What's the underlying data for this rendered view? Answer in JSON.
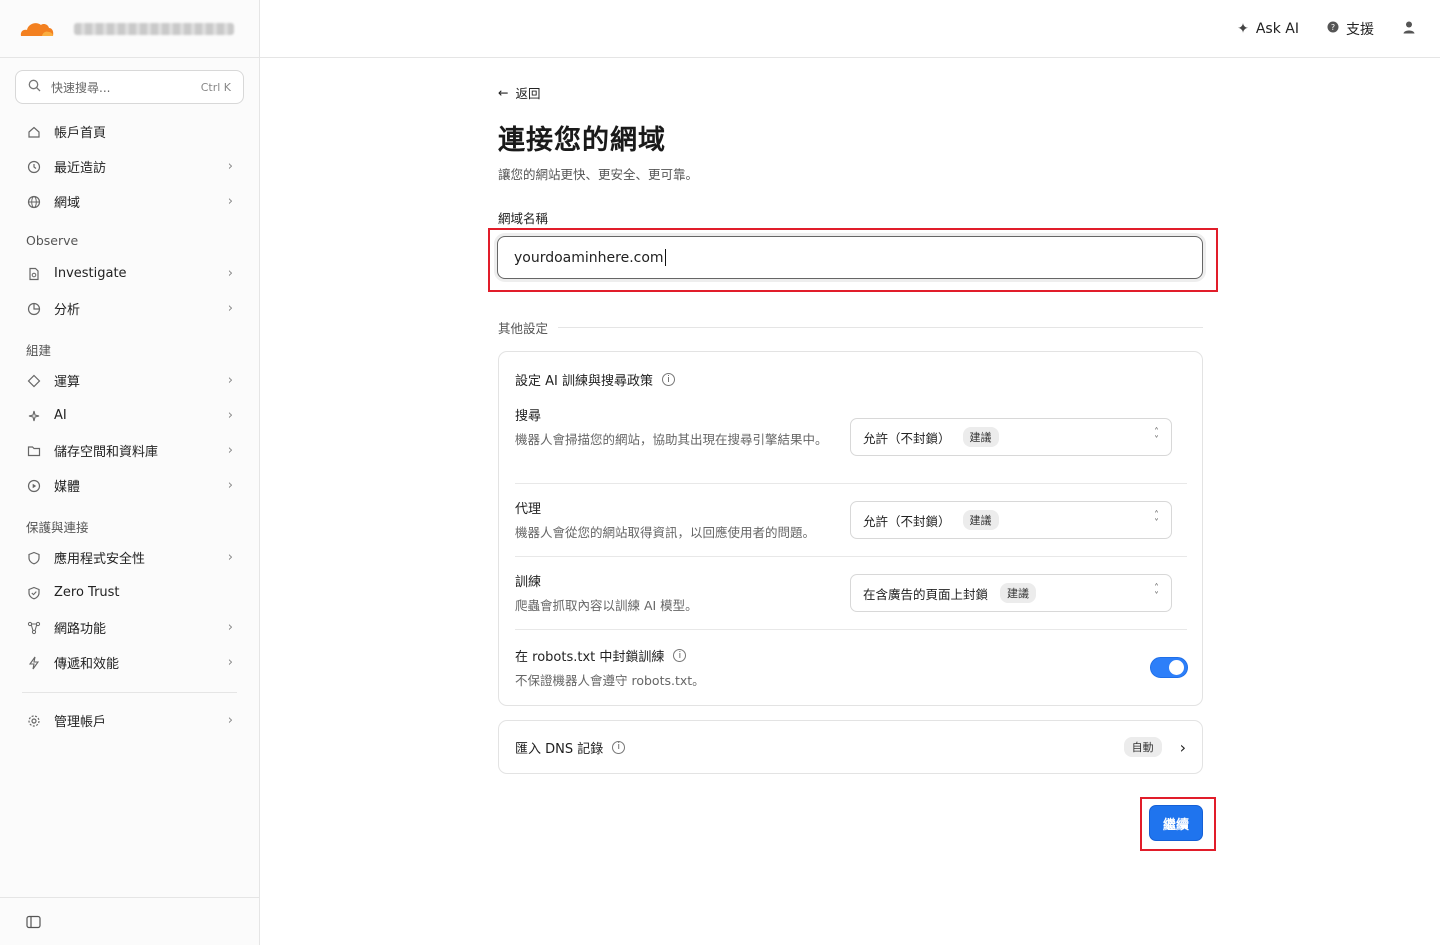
{
  "header": {
    "ask_ai": "Ask AI",
    "support": "支援"
  },
  "sidebar": {
    "search_placeholder": "快速搜尋...",
    "search_shortcut": "Ctrl K",
    "items_top": [
      {
        "label": "帳戶首頁"
      },
      {
        "label": "最近造訪"
      },
      {
        "label": "網域"
      }
    ],
    "section_observe": "Observe",
    "items_observe": [
      {
        "label": "Investigate"
      },
      {
        "label": "分析"
      }
    ],
    "section_build": "組建",
    "items_build": [
      {
        "label": "運算"
      },
      {
        "label": "AI"
      },
      {
        "label": "儲存空間和資料庫"
      },
      {
        "label": "媒體"
      }
    ],
    "section_protect": "保護與連接",
    "items_protect": [
      {
        "label": "應用程式安全性"
      },
      {
        "label": "Zero Trust"
      },
      {
        "label": "網路功能"
      },
      {
        "label": "傳遞和效能"
      }
    ],
    "manage": "管理帳戶"
  },
  "main": {
    "back": "返回",
    "title": "連接您的網域",
    "subtitle": "讓您的網站更快、更安全、更可靠。",
    "domain_label": "網域名稱",
    "domain_value": "yourdoaminhere.com",
    "other_settings": "其他設定",
    "ai_card": {
      "title": "設定 AI 訓練與搜尋政策",
      "search": {
        "title": "搜尋",
        "desc": "機器人會掃描您的網站，協助其出現在搜尋引擎結果中。",
        "value": "允許（不封鎖）",
        "badge": "建議"
      },
      "agent": {
        "title": "代理",
        "desc": "機器人會從您的網站取得資訊，以回應使用者的問題。",
        "value": "允許（不封鎖）",
        "badge": "建議"
      },
      "train": {
        "title": "訓練",
        "desc": "爬蟲會抓取內容以訓練 AI 模型。",
        "value": "在含廣告的頁面上封鎖",
        "badge": "建議"
      },
      "robots": {
        "title": "在 robots.txt 中封鎖訓練",
        "desc": "不保證機器人會遵守 robots.txt。",
        "enabled": true
      }
    },
    "dns": {
      "title": "匯入 DNS 記錄",
      "badge": "自動"
    },
    "continue": "繼續"
  },
  "colors": {
    "accent": "#1f74ee",
    "brand": "#f38020",
    "highlight": "#e11d2a"
  }
}
